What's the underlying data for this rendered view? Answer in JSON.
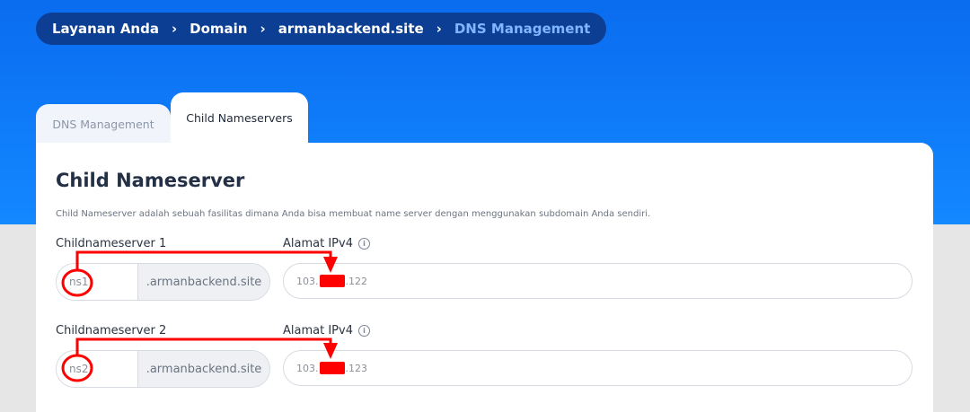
{
  "breadcrumb": {
    "items": [
      "Layanan Anda",
      "Domain",
      "armanbackend.site",
      "DNS Management"
    ],
    "separator": "›"
  },
  "tabs": [
    {
      "label": "DNS Management",
      "active": false
    },
    {
      "label": "Child Nameservers",
      "active": true
    }
  ],
  "card": {
    "title": "Child Nameserver",
    "description": "Child Nameserver adalah sebuah fasilitas dimana Anda bisa membuat name server dengan menggunakan subdomain Anda sendiri."
  },
  "rows": [
    {
      "ns_label": "Childnameserver 1",
      "ns_value": "ns1",
      "suffix": ".armanbackend.site",
      "ip_label": "Alamat IPv4",
      "ip_prefix": "103.",
      "ip_suffix": ".122"
    },
    {
      "ns_label": "Childnameserver 2",
      "ns_value": "ns2",
      "suffix": ".armanbackend.site",
      "ip_label": "Alamat IPv4",
      "ip_prefix": "103.",
      "ip_suffix": ".123"
    }
  ],
  "colors": {
    "hero": "#0a6cf0",
    "breadcrumb_bg": "#0c3f94",
    "breadcrumb_current": "#7fb6ff",
    "annotation": "#ff0000"
  },
  "icons": {
    "info": "info-icon",
    "chevron": "chevron-right-icon"
  }
}
